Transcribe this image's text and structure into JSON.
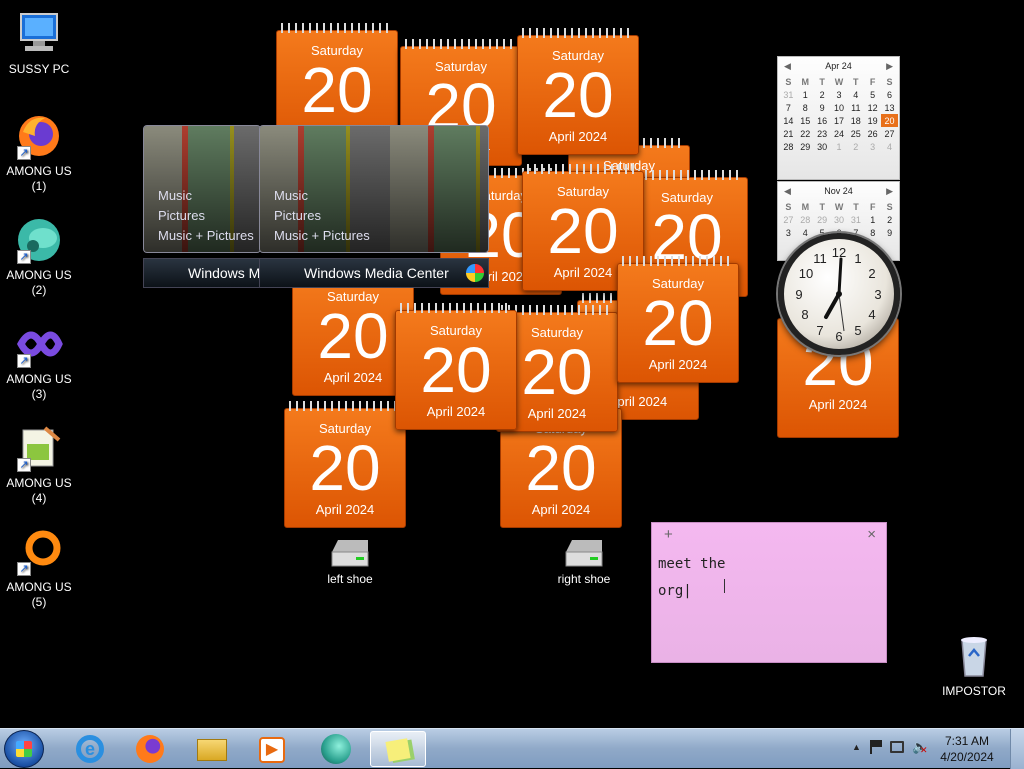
{
  "desktop_icons": [
    {
      "label1": "SUSSY PC",
      "label2": "",
      "icon": "computer-icon"
    },
    {
      "label1": "AMONG US",
      "label2": "(1)",
      "icon": "firefox-icon"
    },
    {
      "label1": "AMONG US",
      "label2": "(2)",
      "icon": "globe-icon"
    },
    {
      "label1": "AMONG US",
      "label2": "(3)",
      "icon": "visual-studio-icon"
    },
    {
      "label1": "AMONG US",
      "label2": "(4)",
      "icon": "notepad-plus-icon"
    },
    {
      "label1": "AMONG US",
      "label2": "(5)",
      "icon": "ring-icon"
    }
  ],
  "recycle_bin": {
    "label": "IMPOSTOR",
    "icon": "recycle-bin-icon"
  },
  "calendar_gadget": {
    "weekday": "Saturday",
    "day": "20",
    "month_year": "April 2024"
  },
  "mini_calendar_1": {
    "title": "Apr 24",
    "headers": [
      "S",
      "M",
      "T",
      "W",
      "T",
      "F",
      "S"
    ],
    "rows": [
      [
        "31",
        "1",
        "2",
        "3",
        "4",
        "5",
        "6"
      ],
      [
        "7",
        "8",
        "9",
        "10",
        "11",
        "12",
        "13"
      ],
      [
        "14",
        "15",
        "16",
        "17",
        "18",
        "19",
        "20"
      ],
      [
        "21",
        "22",
        "23",
        "24",
        "25",
        "26",
        "27"
      ],
      [
        "28",
        "29",
        "30",
        "1",
        "2",
        "3",
        "4"
      ]
    ]
  },
  "mini_calendar_2": {
    "title": "Nov 24",
    "headers": [
      "S",
      "M",
      "T",
      "W",
      "T",
      "F",
      "S"
    ],
    "rows": [
      [
        "27",
        "28",
        "29",
        "30",
        "31",
        "1",
        "2"
      ],
      [
        "3",
        "4",
        "5",
        "6",
        "7",
        "8",
        "9"
      ]
    ]
  },
  "clock_gadget": {
    "numerals": [
      "12",
      "1",
      "2",
      "3",
      "4",
      "5",
      "6",
      "7",
      "8",
      "9",
      "10",
      "11"
    ],
    "time": "7:31"
  },
  "media_center": {
    "items": [
      "Music",
      "Pictures",
      "Music + Pictures"
    ],
    "brand": "Windows",
    "brand_suffix": "Media Center",
    "brand_cut": "Windows M"
  },
  "drives": [
    {
      "label": "left shoe",
      "icon": "drive-icon"
    },
    {
      "label": "right shoe",
      "icon": "drive-icon"
    }
  ],
  "sticky_note": {
    "add": "+",
    "close": "×",
    "line1": "meet the",
    "line2": "org|"
  },
  "taskbar": {
    "items": [
      "internet-explorer-icon",
      "firefox-icon",
      "file-explorer-icon",
      "media-player-icon",
      "globe-icon",
      "sticky-notes-icon"
    ],
    "time": "7:31 AM",
    "date": "4/20/2024",
    "tray_arrow": "▲"
  },
  "colors": {
    "calendar_orange": "#e8620c",
    "sticky_pink": "#f2b6ee",
    "taskbar_blue": "#9fb7d4"
  }
}
